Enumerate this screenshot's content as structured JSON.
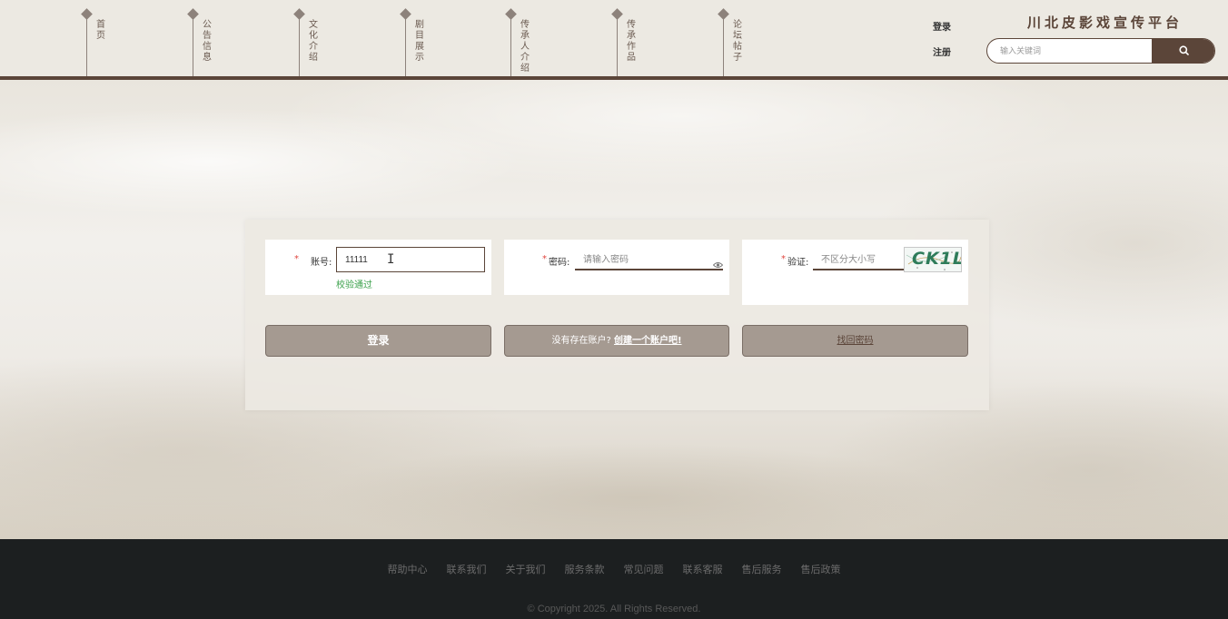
{
  "header": {
    "nav": [
      {
        "label": "首页"
      },
      {
        "label": "公告信息"
      },
      {
        "label": "文化介绍"
      },
      {
        "label": "剧目展示"
      },
      {
        "label": "传承人介绍"
      },
      {
        "label": "传承作品"
      },
      {
        "label": "论坛帖子"
      }
    ],
    "login_link": "登录",
    "register_link": "注册",
    "brand": "川北皮影戏宣传平台",
    "search": {
      "placeholder": "输入关键词",
      "icon": "search-icon"
    }
  },
  "login_form": {
    "account": {
      "label": "账号:",
      "required": "*",
      "value": "11111",
      "status": "校验通过"
    },
    "password": {
      "label": "密码:",
      "required": "*",
      "placeholder": "请输入密码",
      "icon": "eye-icon"
    },
    "captcha": {
      "label": "验证:",
      "required": "*",
      "placeholder": "不区分大小写",
      "code": "CK1L"
    },
    "login_button": "登录",
    "register_prompt": "没有存在账户?",
    "register_link": "创建一个账户吧!",
    "forgot_link": "找回密码"
  },
  "footer": {
    "links": [
      "帮助中心",
      "联系我们",
      "关于我们",
      "服务条款",
      "常见问题",
      "联系客服",
      "售后服务",
      "售后政策"
    ],
    "copyright": "© Copyright 2025. All Rights Reserved."
  },
  "colors": {
    "accent": "#5b4539",
    "button": "#a59a91",
    "success": "#3aa04a",
    "required": "#e0473f",
    "footer": "#1c1f20"
  }
}
